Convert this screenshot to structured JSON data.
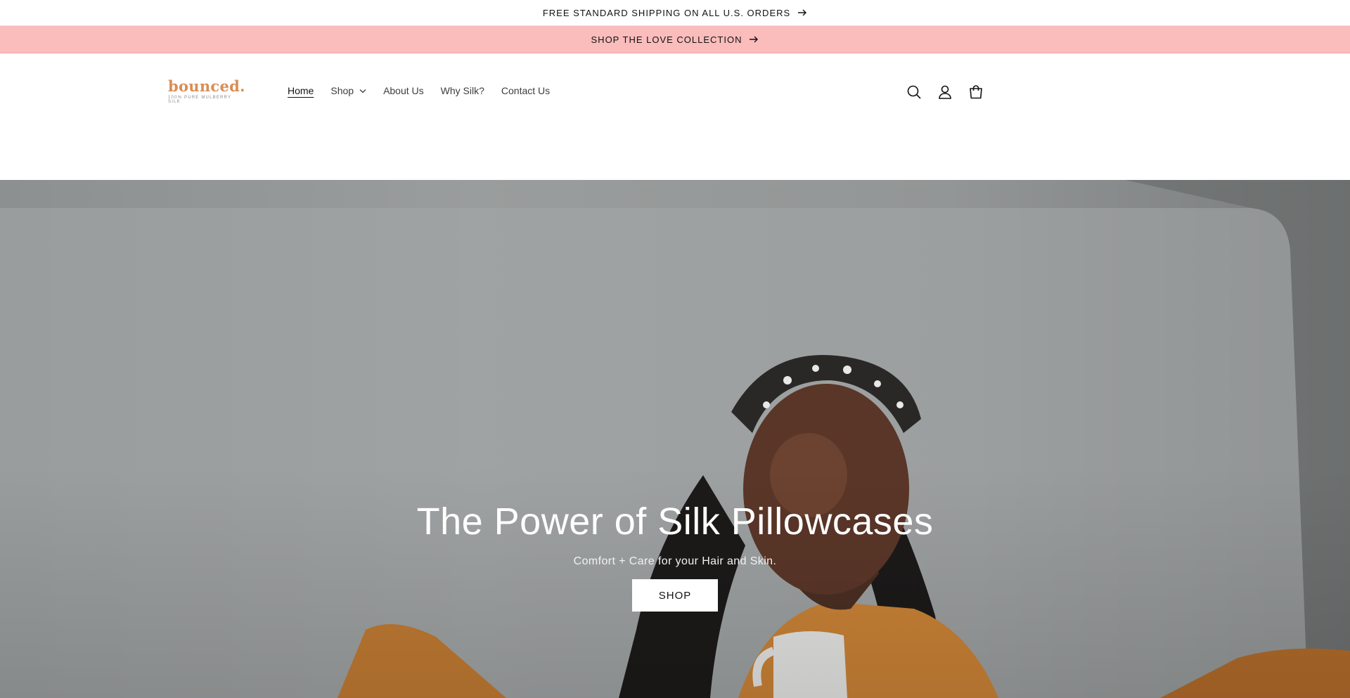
{
  "announcements": {
    "shipping": "FREE STANDARD SHIPPING ON ALL U.S. ORDERS",
    "collection": "SHOP THE LOVE COLLECTION"
  },
  "logo": {
    "word": "bounced.",
    "tagline": "100% PURE MULBERRY SILK"
  },
  "nav": {
    "items": [
      {
        "label": "Home",
        "active": true
      },
      {
        "label": "Shop",
        "dropdown": true
      },
      {
        "label": "About Us"
      },
      {
        "label": "Why Silk?"
      },
      {
        "label": "Contact Us"
      }
    ]
  },
  "header_icons": [
    "search-icon",
    "account-icon",
    "cart-icon"
  ],
  "hero": {
    "title": "The Power of Silk Pillowcases",
    "subtitle": "Comfort + Care for your Hair and Skin.",
    "button_label": "SHOP"
  },
  "colors": {
    "announcement_pink": "#fbbcbc",
    "logo_orange": "#d98e54",
    "hero_text": "#ffffff"
  }
}
